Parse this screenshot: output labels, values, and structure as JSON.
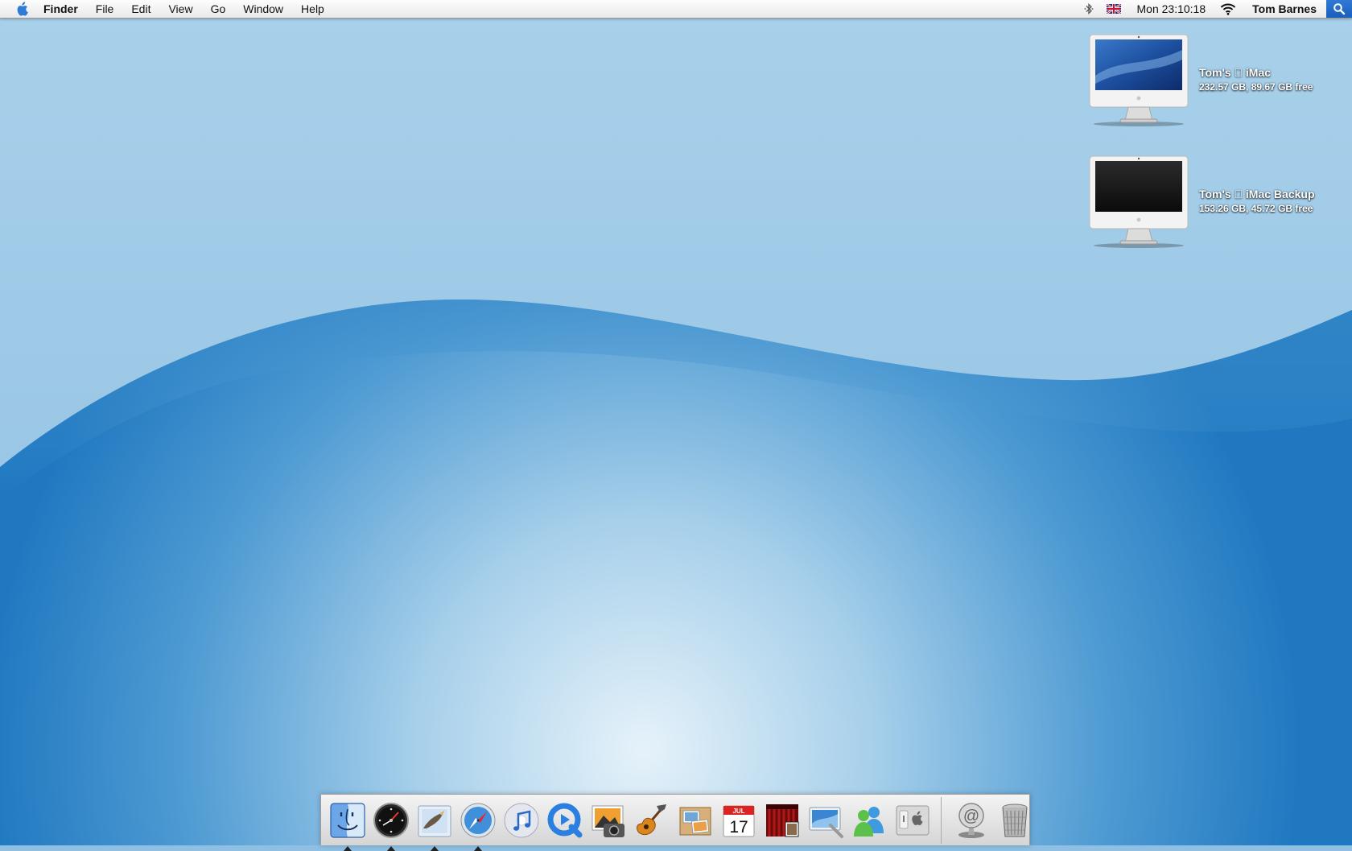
{
  "menubar": {
    "app_name": "Finder",
    "menus": [
      "File",
      "Edit",
      "View",
      "Go",
      "Window",
      "Help"
    ],
    "clock": "Mon 23:10:18",
    "user": "Tom Barnes",
    "status_icons": [
      "bluetooth-icon",
      "uk-flag-icon",
      "wifi-icon",
      "spotlight-icon"
    ]
  },
  "desktop": {
    "drives": [
      {
        "name": "Tom's  iMac",
        "info": "232.57 GB, 89.67 GB free",
        "screen": "blue"
      },
      {
        "name": "Tom's  iMac Backup",
        "info": "153.26 GB, 45.72 GB free",
        "screen": "black"
      }
    ]
  },
  "dock": {
    "apps": [
      {
        "name": "finder-icon",
        "running": true
      },
      {
        "name": "dashboard-icon",
        "running": true
      },
      {
        "name": "mail-icon",
        "running": true
      },
      {
        "name": "safari-icon",
        "running": true
      },
      {
        "name": "itunes-icon",
        "running": false
      },
      {
        "name": "quicktime-icon",
        "running": false
      },
      {
        "name": "iphoto-icon",
        "running": false
      },
      {
        "name": "garageband-icon",
        "running": false
      },
      {
        "name": "preview-icon",
        "running": false
      },
      {
        "name": "ical-icon",
        "running": false
      },
      {
        "name": "frontrow-icon",
        "running": false
      },
      {
        "name": "iweb-icon",
        "running": false
      },
      {
        "name": "msn-messenger-icon",
        "running": false
      },
      {
        "name": "system-preferences-icon",
        "running": false
      }
    ],
    "ical_month": "JUL",
    "ical_day": "17",
    "others": [
      {
        "name": "internet-connect-icon"
      },
      {
        "name": "trash-icon"
      }
    ]
  },
  "colors": {
    "wallpaper_light": "#e3f0f9",
    "wallpaper_mid": "#8cc0e3",
    "wallpaper_dark": "#1e78c2",
    "spotlight": "#2f7ad6"
  }
}
